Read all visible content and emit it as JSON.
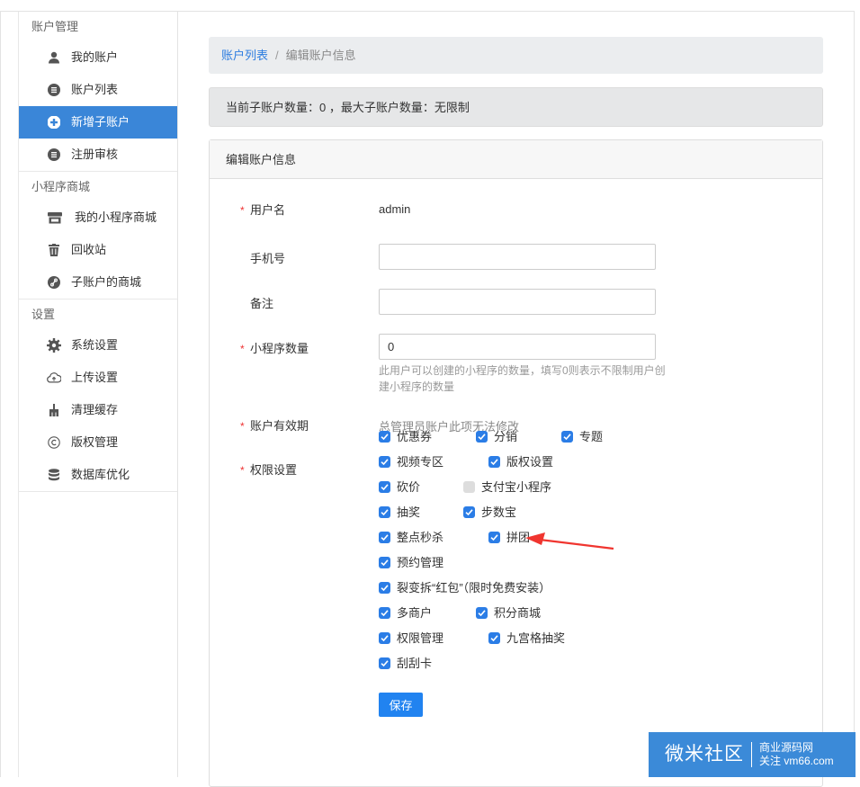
{
  "sidebar": {
    "groups": [
      {
        "title": "账户管理",
        "items": [
          {
            "label": "我的账户",
            "icon": "user-icon"
          },
          {
            "label": "账户列表",
            "icon": "list-icon"
          },
          {
            "label": "新增子账户",
            "icon": "plus-circle-icon",
            "active": true
          },
          {
            "label": "注册审核",
            "icon": "list-icon"
          }
        ]
      },
      {
        "title": "小程序商城",
        "items": [
          {
            "label": "我的小程序商城",
            "icon": "store-icon"
          },
          {
            "label": "回收站",
            "icon": "trash-icon"
          },
          {
            "label": "子账户的商城",
            "icon": "link-icon"
          }
        ]
      },
      {
        "title": "设置",
        "items": [
          {
            "label": "系统设置",
            "icon": "gear-icon"
          },
          {
            "label": "上传设置",
            "icon": "cloud-upload-icon"
          },
          {
            "label": "清理缓存",
            "icon": "broom-icon"
          },
          {
            "label": "版权管理",
            "icon": "copyright-icon"
          },
          {
            "label": "数据库优化",
            "icon": "database-icon"
          }
        ]
      }
    ]
  },
  "breadcrumb": {
    "link": "账户列表",
    "sep": "/",
    "current": "编辑账户信息"
  },
  "notice": "当前子账户数量：0 ，最大子账户数量：无限制",
  "card": {
    "title": "编辑账户信息"
  },
  "form": {
    "username_label": "用户名",
    "username_value": "admin",
    "phone_label": "手机号",
    "phone_value": "",
    "remark_label": "备注",
    "remark_value": "",
    "app_count_label": "小程序数量",
    "app_count_value": "0",
    "app_count_help": "此用户可以创建的小程序的数量，填写0则表示不限制用户创建小程序的数量",
    "validity_label": "账户有效期",
    "validity_value": "总管理员账户此项无法修改",
    "perm_label": "权限设置",
    "required_mark": "*",
    "save_label": "保存"
  },
  "permissions": [
    {
      "label": "优惠券",
      "checked": true
    },
    {
      "label": "分销",
      "checked": true
    },
    {
      "label": "专题",
      "checked": true
    },
    {
      "label": "视频专区",
      "checked": true
    },
    {
      "label": "版权设置",
      "checked": true
    },
    {
      "label": "砍价",
      "checked": true
    },
    {
      "label": "支付宝小程序",
      "checked": false
    },
    {
      "label": "抽奖",
      "checked": true
    },
    {
      "label": "步数宝",
      "checked": true
    },
    {
      "label": "整点秒杀",
      "checked": true
    },
    {
      "label": "拼团",
      "checked": true
    },
    {
      "label": "预约管理",
      "checked": true
    },
    {
      "label": "裂变拆“红包”（限时免费安装）",
      "checked": true
    },
    {
      "label": "多商户",
      "checked": true
    },
    {
      "label": "积分商城",
      "checked": true
    },
    {
      "label": "权限管理",
      "checked": true
    },
    {
      "label": "九宫格抽奖",
      "checked": true
    },
    {
      "label": "刮刮卡",
      "checked": true
    }
  ],
  "watermark": {
    "big": "微米社区",
    "line1": "商业源码网",
    "line2": "关注 vm66.com"
  },
  "colors": {
    "accent": "#3a86d8",
    "checkbox": "#2b7de6",
    "arrow": "#f0352f"
  }
}
